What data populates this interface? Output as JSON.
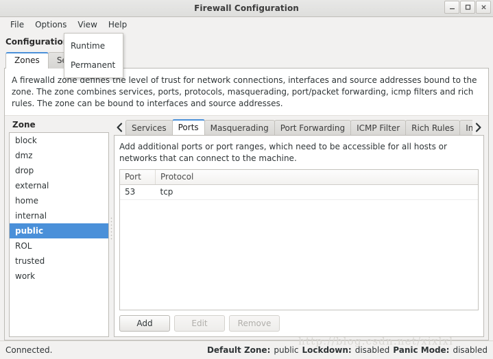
{
  "window": {
    "title": "Firewall Configuration",
    "controls": [
      {
        "name": "minimize",
        "glyph": "_"
      },
      {
        "name": "maximize",
        "glyph": "□"
      },
      {
        "name": "close",
        "glyph": "✕"
      }
    ]
  },
  "menubar": {
    "items": [
      "File",
      "Options",
      "View",
      "Help"
    ]
  },
  "dropdown": {
    "open": true,
    "items": [
      "Runtime",
      "Permanent"
    ]
  },
  "configuration": {
    "label": "Configuration:",
    "value": ""
  },
  "top_tabs": [
    {
      "label": "Zones",
      "active": true
    },
    {
      "label": "Services",
      "active": false
    }
  ],
  "zone_description": "A firewalld zone defines the level of trust for network connections, interfaces and source addresses bound to the zone. The zone combines services, ports, protocols, masquerading, port/packet forwarding, icmp filters and rich rules. The zone can be bound to interfaces and source addresses.",
  "zone_panel": {
    "header": "Zone",
    "items": [
      {
        "label": "block",
        "selected": false
      },
      {
        "label": "dmz",
        "selected": false
      },
      {
        "label": "drop",
        "selected": false
      },
      {
        "label": "external",
        "selected": false
      },
      {
        "label": "home",
        "selected": false
      },
      {
        "label": "internal",
        "selected": false
      },
      {
        "label": "public",
        "selected": true
      },
      {
        "label": "ROL",
        "selected": false
      },
      {
        "label": "trusted",
        "selected": false
      },
      {
        "label": "work",
        "selected": false
      }
    ]
  },
  "detail_tabs": {
    "scroll_left_icon": "chevron-left-icon",
    "scroll_right_icon": "chevron-right-icon",
    "items": [
      {
        "label": "Services",
        "active": false
      },
      {
        "label": "Ports",
        "active": true
      },
      {
        "label": "Masquerading",
        "active": false
      },
      {
        "label": "Port Forwarding",
        "active": false
      },
      {
        "label": "ICMP Filter",
        "active": false
      },
      {
        "label": "Rich Rules",
        "active": false
      },
      {
        "label": "Interfaces",
        "active": false
      }
    ]
  },
  "ports_panel": {
    "description": "Add additional ports or port ranges, which need to be accessible for all hosts or networks that can connect to the machine.",
    "columns": [
      "Port",
      "Protocol"
    ],
    "rows": [
      {
        "port": "53",
        "protocol": "tcp"
      }
    ],
    "buttons": [
      {
        "label": "Add",
        "enabled": true
      },
      {
        "label": "Edit",
        "enabled": false
      },
      {
        "label": "Remove",
        "enabled": false
      }
    ]
  },
  "statusbar": {
    "connection": "Connected.",
    "default_zone_label": "Default Zone:",
    "default_zone_value": "public",
    "lockdown_label": "Lockdown:",
    "lockdown_value": "disabled",
    "panic_label": "Panic Mode:",
    "panic_value": "disabled"
  },
  "watermark": "http://blog.csdn.net/xixlxl",
  "colors": {
    "selection_blue": "#4a90d9",
    "window_bg": "#f2f1f0",
    "panel_white": "#ffffff",
    "text": "#2e3436"
  }
}
